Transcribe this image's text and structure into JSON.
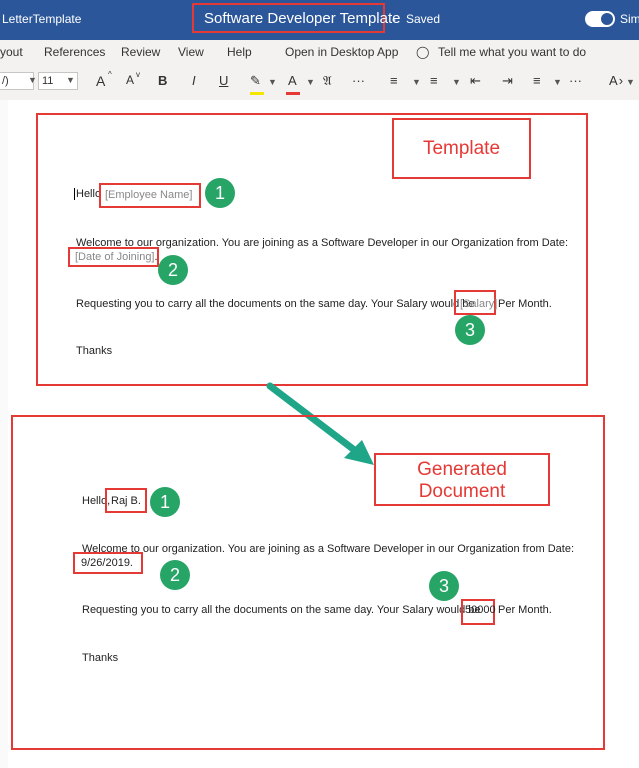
{
  "titlebar": {
    "file_name": "LetterTemplate",
    "doc_title": "Software Developer Template",
    "separator": "-",
    "save_status": "Saved",
    "simplified_label": "Sim"
  },
  "menu": {
    "layout": "yout",
    "references": "References",
    "review": "Review",
    "view": "View",
    "help": "Help",
    "open_desktop": "Open in Desktop App",
    "tell_me": "Tell me what you want to do"
  },
  "toolbar": {
    "font_name": "/)",
    "font_size": "11",
    "grow_font": "A",
    "shrink_font": "A",
    "bold": "B",
    "italic": "I",
    "underline": "U",
    "font_color_glyph": "A",
    "more": "···",
    "highlight_color": "#f5e500",
    "font_color": "#e53935"
  },
  "template": {
    "label": "Template",
    "hello": "Hello",
    "employee_name": "[Employee Name]",
    "welcome_line": "Welcome to our organization. You are joining as a Software Developer in our Organization from Date:",
    "date_of_joining": "[Date of Joining]",
    "date_suffix": ".",
    "salary_prefix": "Requesting you to carry all the documents on the same day. Your Salary would be",
    "salary": "[Salary]",
    "salary_suffix": "Per Month.",
    "thanks": "Thanks"
  },
  "generated": {
    "label_line1": "Generated",
    "label_line2": "Document",
    "hello": "Hello,",
    "employee_name": "Raj B.",
    "welcome_line": "Welcome to our organization. You are joining as a Software Developer in our Organization from Date:",
    "date_of_joining": "9/26/2019.",
    "salary_prefix": "Requesting you to carry all the documents on the same day. Your Salary would be",
    "salary": "50000",
    "salary_suffix": "Per Month.",
    "thanks": "Thanks"
  },
  "badges": {
    "one": "1",
    "two": "2",
    "three": "3"
  },
  "colors": {
    "title_bar": "#2b579a",
    "annotation_red": "#e53935",
    "badge_green": "#27a567",
    "arrow_teal": "#1fa588"
  }
}
